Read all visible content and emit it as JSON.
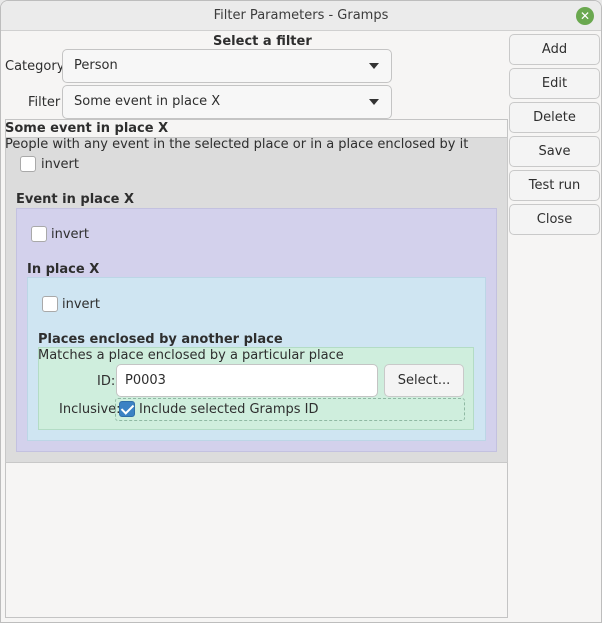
{
  "window": {
    "title": "Filter Parameters - Gramps"
  },
  "header": {
    "select_filter": "Select a filter",
    "category_label": "Category",
    "category_value": "Person",
    "filter_label": "Filter",
    "filter_value": "Some event in place X"
  },
  "rule1": {
    "title": "Some event in place X",
    "description": "People with any event in the selected place or in a place enclosed by it",
    "invert_label": "invert"
  },
  "rule2": {
    "title": "Event in place X",
    "invert_label": "invert"
  },
  "rule3": {
    "title": "In place X",
    "invert_label": "invert"
  },
  "rule4": {
    "title": "Places enclosed by another place",
    "description": "Matches a place enclosed by a particular place",
    "id_label": "ID:",
    "id_value": "P0003",
    "select_button": "Select...",
    "inclusive_label": "Inclusive:",
    "inclusive_checkbox_label": "Include selected Gramps ID"
  },
  "side_buttons": {
    "add": "Add",
    "edit": "Edit",
    "delete": "Delete",
    "save": "Save",
    "test_run": "Test run",
    "close": "Close"
  },
  "colors": {
    "level1": "#dcdcdc",
    "level2": "#d3d1ec",
    "level3": "#cfe5f2",
    "level4": "#cfeedd",
    "checkbox_checked": "#3b82c4"
  }
}
